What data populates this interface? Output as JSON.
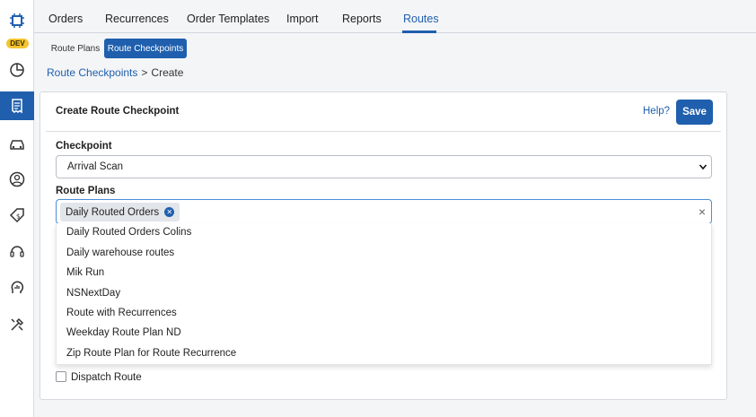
{
  "env_badge": "DEV",
  "sidebar": {
    "items": [
      {
        "icon": "logo-icon"
      },
      {
        "icon": "pie-chart-icon"
      },
      {
        "icon": "receipt-icon",
        "active": true
      },
      {
        "icon": "car-icon"
      },
      {
        "icon": "user-circle-icon"
      },
      {
        "icon": "price-tag-icon"
      },
      {
        "icon": "headset-icon"
      },
      {
        "icon": "analytics-head-icon"
      },
      {
        "icon": "tools-icon"
      }
    ]
  },
  "topnav": {
    "items": [
      "Orders",
      "Recurrences",
      "Order Templates",
      "Import",
      "Reports",
      "Routes"
    ],
    "active": "Routes"
  },
  "subtabs": {
    "items": [
      "Route Plans",
      "Route Checkpoints"
    ],
    "active": "Route Checkpoints"
  },
  "breadcrumb": {
    "link": "Route Checkpoints",
    "separator": ">",
    "current": "Create"
  },
  "card": {
    "title": "Create Route Checkpoint",
    "help_label": "Help?",
    "save_label": "Save"
  },
  "form": {
    "checkpoint_label": "Checkpoint",
    "checkpoint_value": "Arrival Scan",
    "route_plans_label": "Route Plans",
    "selected_chip": "Daily Routed Orders",
    "options": [
      "Daily Routed Orders Colins",
      "Daily warehouse routes",
      "Mik Run",
      "NSNextDay",
      "Route with Recurrences",
      "Weekday Route Plan ND",
      "Zip Route Plan for Route Recurrence"
    ],
    "dispatch_label": "Dispatch Route",
    "dispatch_checked": false
  },
  "colors": {
    "accent": "#1f5fae",
    "badge": "#f4c430"
  }
}
